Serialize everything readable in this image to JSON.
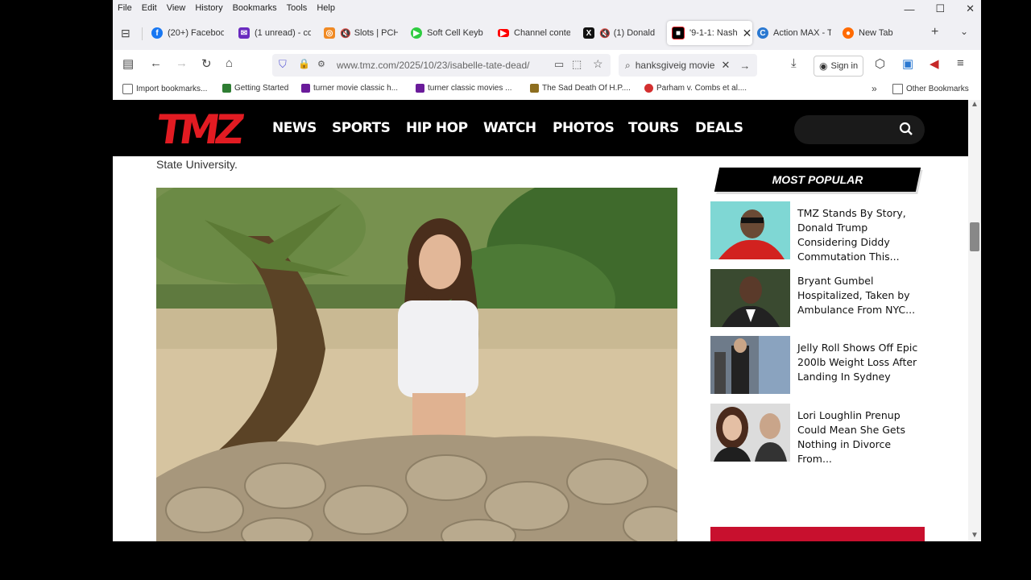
{
  "menu": [
    "File",
    "Edit",
    "View",
    "History",
    "Bookmarks",
    "Tools",
    "Help"
  ],
  "tabs": [
    {
      "label": "(20+) Faceboo",
      "color": "#1877f2",
      "glyph": "f"
    },
    {
      "label": "(1 unread) - co",
      "color": "#6a2bbf",
      "glyph": "✉"
    },
    {
      "label": "Slots | PCH",
      "color": "#f08a24",
      "glyph": "◎"
    },
    {
      "label": "Soft Cell Keybo",
      "color": "#2ecc40",
      "glyph": "▶"
    },
    {
      "label": "Channel conte",
      "color": "#ff0000",
      "glyph": "▶"
    },
    {
      "label": "(1) Donald",
      "color": "#111111",
      "glyph": "X"
    },
    {
      "label": "'9-1-1: Nash",
      "color": "#000000",
      "glyph": "■"
    },
    {
      "label": "Action MAX - T",
      "color": "#2a78d1",
      "glyph": "C"
    },
    {
      "label": "New Tab",
      "color": "#ff6a00",
      "glyph": "●"
    }
  ],
  "url": "www.tmz.com/2025/10/23/isabelle-tate-dead/",
  "search_text": "hanksgiveig movie",
  "signin_label": "Sign in",
  "bookmarks": [
    {
      "label": "Import bookmarks...",
      "color": "#666666"
    },
    {
      "label": "Getting Started",
      "color": "#2e7d32"
    },
    {
      "label": "turner movie classic h...",
      "color": "#6a1b9a"
    },
    {
      "label": "turner classic movies ...",
      "color": "#6a1b9a"
    },
    {
      "label": "The Sad Death Of H.P....",
      "color": "#8d6e1f"
    },
    {
      "label": "Parham v. Combs et al....",
      "color": "#d32f2f"
    }
  ],
  "other_bookmarks": "Other Bookmarks",
  "site": {
    "logo": "TMZ",
    "nav": [
      "NEWS",
      "SPORTS",
      "HIP HOP",
      "WATCH",
      "PHOTOS",
      "TOURS",
      "DEALS"
    ]
  },
  "article": {
    "caption_tail": "State University."
  },
  "most_popular": {
    "title": "MOST POPULAR",
    "items": [
      {
        "headline": "TMZ Stands By Story, Donald Trump Considering Diddy Commutation This..."
      },
      {
        "headline": "Bryant Gumbel Hospitalized, Taken by Ambulance From NYC..."
      },
      {
        "headline": "Jelly Roll Shows Off Epic 200lb Weight Loss After Landing In Sydney"
      },
      {
        "headline": "Lori Loughlin Prenup Could Mean She Gets Nothing in Divorce From..."
      }
    ]
  }
}
